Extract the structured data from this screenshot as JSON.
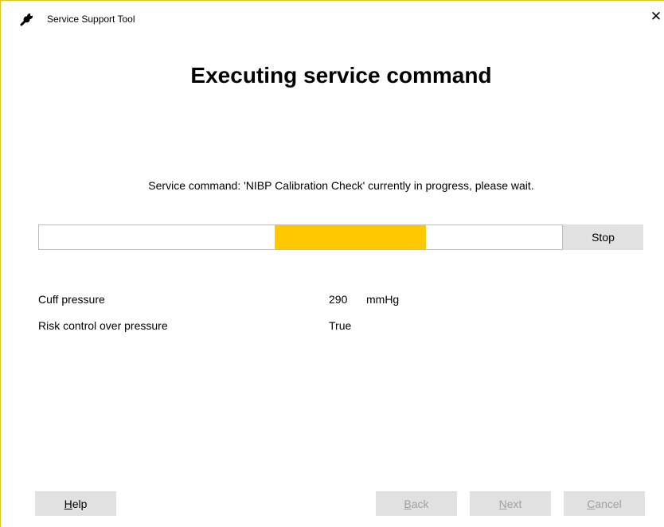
{
  "window": {
    "title": "Service Support Tool",
    "icon": "wrench-icon",
    "close_label": "✕"
  },
  "heading": "Executing service command",
  "status_message": "Service command: 'NIBP Calibration Check' currently in progress, please wait.",
  "progress": {
    "indeterminate": true,
    "segment_start_fraction": 0.45,
    "segment_end_fraction": 0.74,
    "color": "#ffc800",
    "stop_label": "Stop"
  },
  "fields": [
    {
      "label": "Cuff pressure",
      "value": "290",
      "unit": "mmHg"
    },
    {
      "label": "Risk control over pressure",
      "value": "True",
      "unit": ""
    }
  ],
  "buttons": {
    "help": {
      "mnemonic": "H",
      "rest": "elp",
      "enabled": true
    },
    "back": {
      "mnemonic": "B",
      "rest": "ack",
      "enabled": false
    },
    "next": {
      "mnemonic": "N",
      "rest": "ext",
      "enabled": false
    },
    "cancel": {
      "mnemonic": "C",
      "rest": "ancel",
      "enabled": false
    }
  },
  "colors": {
    "accent": "#ffc800",
    "window_border": "#f2c200",
    "button_bg": "#e1e1e1",
    "disabled_text": "#a0a0a0"
  }
}
